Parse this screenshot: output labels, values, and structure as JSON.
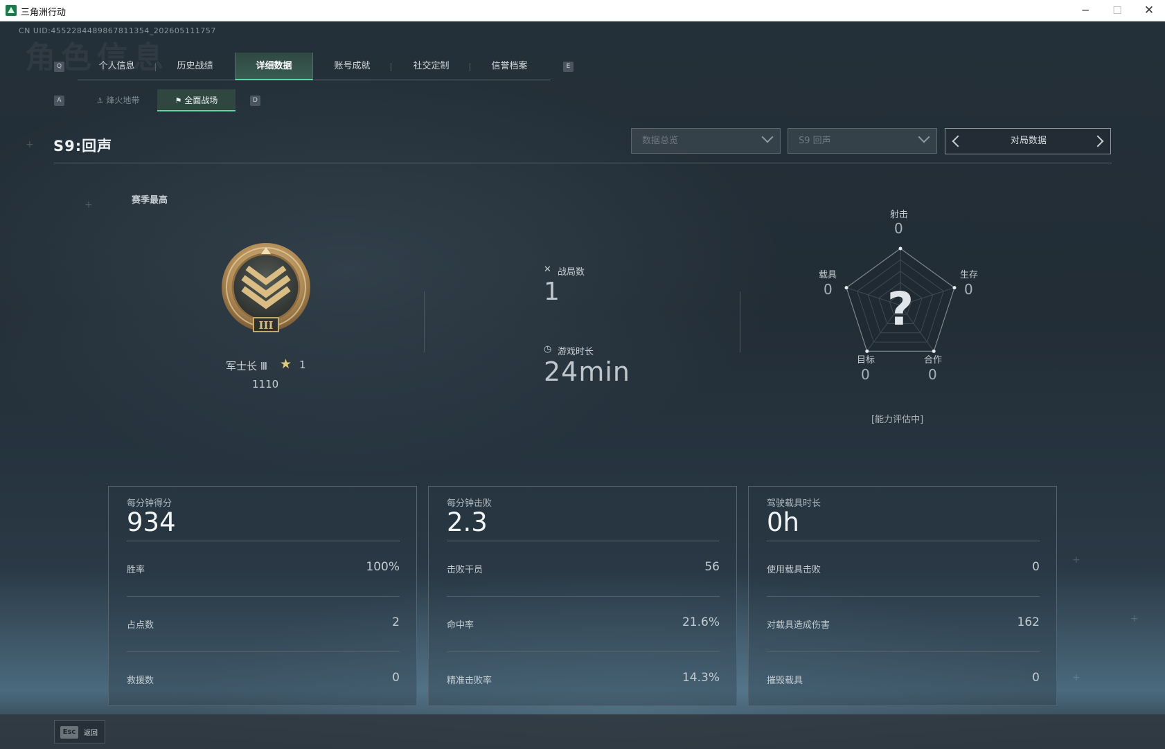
{
  "window": {
    "title": "三角洲行动",
    "minimize": "─",
    "maximize": "☐",
    "close": "✕"
  },
  "uid_line": "CN UID:4552284489867811354_202605111757",
  "watermark": "角色信息",
  "main_tabs": {
    "key_left": "Q",
    "key_right": "E",
    "items": [
      {
        "label": "个人信息"
      },
      {
        "label": "历史战绩"
      },
      {
        "label": "详细数据",
        "active": true
      },
      {
        "label": "账号成就"
      },
      {
        "label": "社交定制"
      },
      {
        "label": "信誉档案"
      }
    ]
  },
  "sub_tabs": {
    "key_left": "A",
    "key_right": "D",
    "items": [
      {
        "label": "烽火地带",
        "icon": "compass-icon"
      },
      {
        "label": "全面战场",
        "icon": "flag-icon",
        "active": true
      }
    ]
  },
  "season": {
    "title": "S9:回声",
    "select_overview": "数据总览",
    "select_season": "S9 回声",
    "pager_label": "对局数据"
  },
  "rank": {
    "section_label": "赛季最高",
    "name": "军士长 Ⅲ",
    "star_glyph": "★",
    "stars": "1",
    "score": "1110",
    "badge_numeral": "III"
  },
  "summary": {
    "matches_label": "战局数",
    "matches_value": "1",
    "playtime_label": "游戏时长",
    "playtime_value": "24min"
  },
  "radar": {
    "center_glyph": "?",
    "axes": [
      {
        "label": "射击",
        "value": "0"
      },
      {
        "label": "生存",
        "value": "0"
      },
      {
        "label": "合作",
        "value": "0"
      },
      {
        "label": "目标",
        "value": "0"
      },
      {
        "label": "载具",
        "value": "0"
      }
    ],
    "note": "[能力评估中]"
  },
  "cards": [
    {
      "head_label": "每分钟得分",
      "head_value": "934",
      "rows": [
        {
          "label": "胜率",
          "value": "100%"
        },
        {
          "label": "占点数",
          "value": "2"
        },
        {
          "label": "救援数",
          "value": "0"
        }
      ]
    },
    {
      "head_label": "每分钟击败",
      "head_value": "2.3",
      "rows": [
        {
          "label": "击败干员",
          "value": "56"
        },
        {
          "label": "命中率",
          "value": "21.6%"
        },
        {
          "label": "精准击败率",
          "value": "14.3%"
        }
      ]
    },
    {
      "head_label": "驾驶载具时长",
      "head_value": "0h",
      "rows": [
        {
          "label": "使用载具击败",
          "value": "0"
        },
        {
          "label": "对载具造成伤害",
          "value": "162"
        },
        {
          "label": "摧毁载具",
          "value": "0"
        }
      ]
    }
  ],
  "bottom": {
    "esc_key": "Esc",
    "esc_label": "返回"
  },
  "colors": {
    "accent": "#5fd6a4",
    "badge_gold": "#c9a96b",
    "panel_border": "#56646d"
  }
}
